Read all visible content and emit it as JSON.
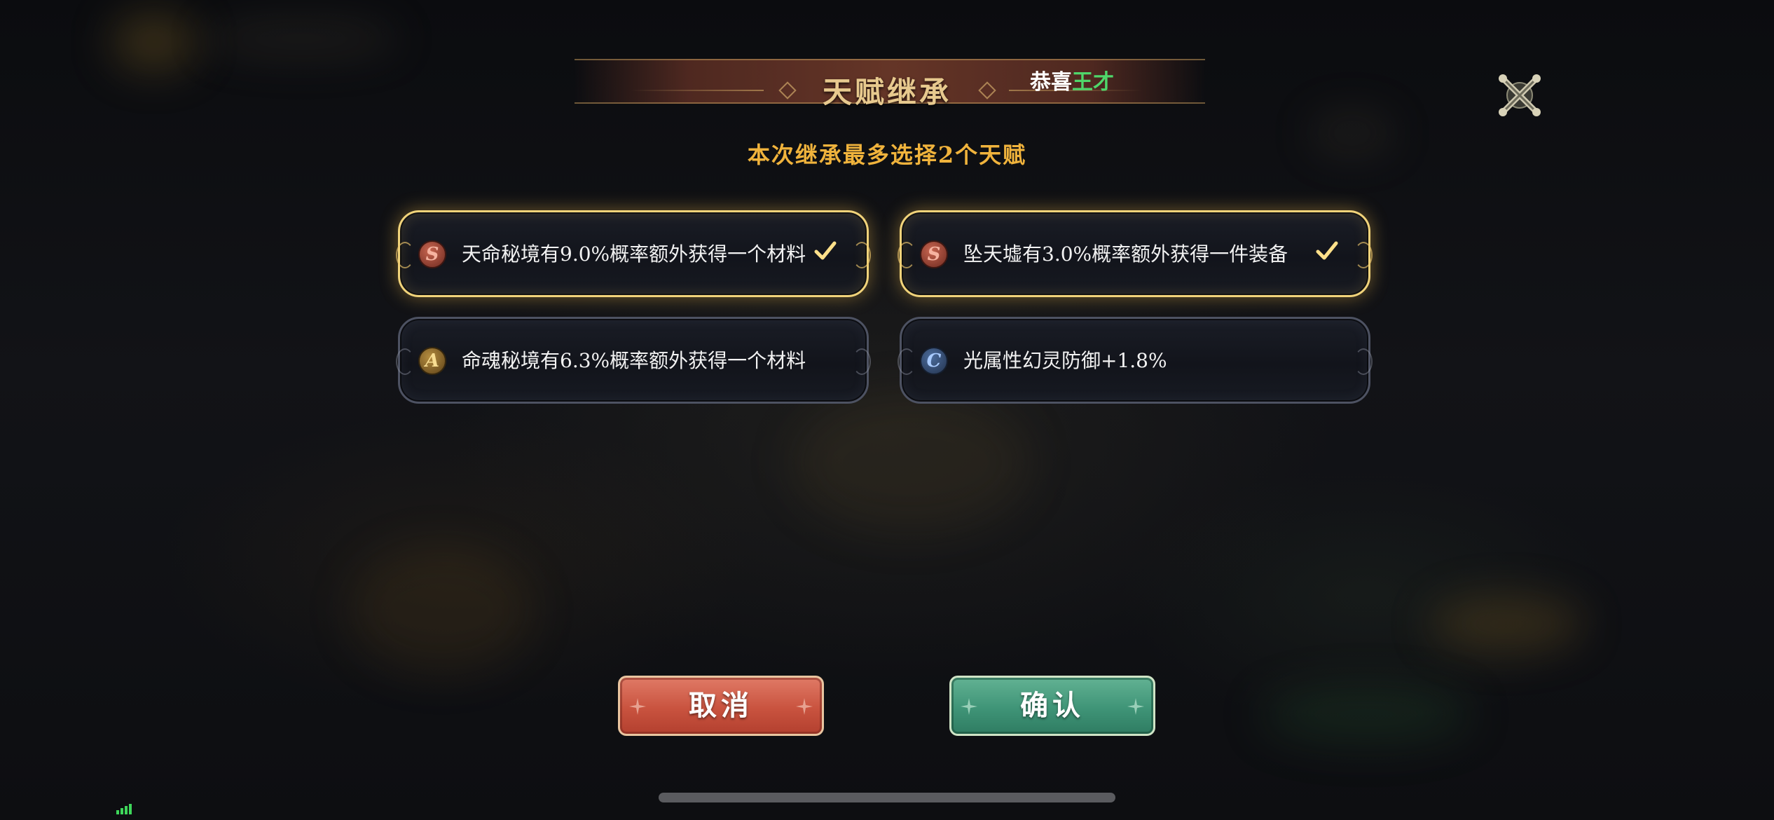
{
  "dialog": {
    "title": "天赋继承",
    "marquee": {
      "prefix": "恭喜",
      "name": "王才"
    },
    "instruction": "本次继承最多选择2个天赋",
    "close_icon": "crossed-swords-close-icon"
  },
  "talents": [
    {
      "grade": "S",
      "text": "天命秘境有9.0%概率额外获得一个材料",
      "selected": true
    },
    {
      "grade": "S",
      "text": "坠天墟有3.0%概率额外获得一件装备",
      "selected": true
    },
    {
      "grade": "A",
      "text": "命魂秘境有6.3%概率额外获得一个材料",
      "selected": false
    },
    {
      "grade": "C",
      "text": "光属性幻灵防御+1.8%",
      "selected": false
    }
  ],
  "buttons": {
    "cancel_label": "取消",
    "confirm_label": "确认"
  },
  "colors": {
    "title": "#e7c98e",
    "instruction": "#f0b33c",
    "selected_border": "#f1d37a",
    "cancel": "#c9533f",
    "confirm": "#3f9477",
    "marquee_name": "#4fd66a"
  }
}
